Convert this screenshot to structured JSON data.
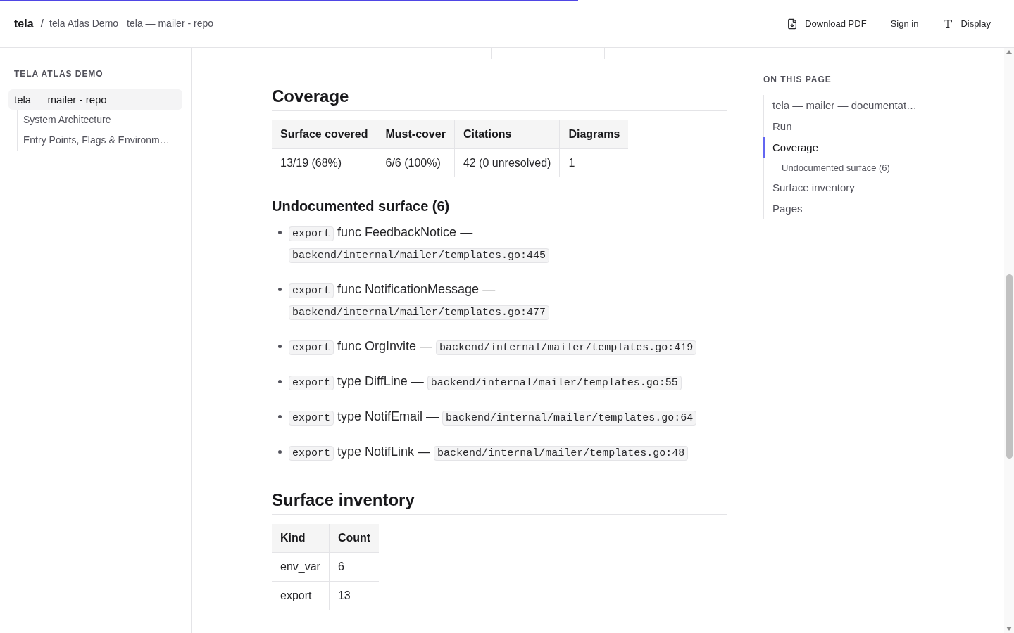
{
  "progress": {
    "level": 0.57
  },
  "header": {
    "brand": "tela",
    "separator": "/",
    "breadcrumbs": [
      "tela Atlas Demo",
      "tela — mailer - repo"
    ],
    "actions": [
      {
        "kind": "download",
        "label": "Download PDF"
      },
      {
        "kind": "link",
        "label": "Sign in"
      },
      {
        "kind": "display",
        "label": "Display"
      }
    ]
  },
  "sidebar": {
    "title": "TELA ATLAS DEMO",
    "items": [
      {
        "label": "tela — mailer - repo",
        "selected": true,
        "children": [
          {
            "label": "System Architecture",
            "selected": false
          },
          {
            "label": "Entry Points, Flags & Environm…",
            "selected": false
          }
        ]
      }
    ]
  },
  "article": {
    "blocks": [
      {
        "kind": "h2",
        "text": "Coverage"
      },
      {
        "kind": "table",
        "columns": [
          "Surface covered",
          "Must-cover",
          "Citations",
          "Diagrams"
        ],
        "rows": [
          [
            "13/19 (68%)",
            "6/6 (100%)",
            "42 (0 unresolved)",
            "1"
          ]
        ]
      },
      {
        "kind": "h3",
        "text": "Undocumented surface (6)"
      },
      {
        "kind": "list",
        "items": [
          {
            "tag": "export",
            "text": "func FeedbackNotice —",
            "path": "backend/internal/mailer/templates.go:445"
          },
          {
            "tag": "export",
            "text": "func NotificationMessage —",
            "path": "backend/internal/mailer/templates.go:477"
          },
          {
            "tag": "export",
            "text": "func OrgInvite —",
            "path": "backend/internal/mailer/templates.go:419"
          },
          {
            "tag": "export",
            "text": "type DiffLine —",
            "path": "backend/internal/mailer/templates.go:55"
          },
          {
            "tag": "export",
            "text": "type NotifEmail —",
            "path": "backend/internal/mailer/templates.go:64"
          },
          {
            "tag": "export",
            "text": "type NotifLink —",
            "path": "backend/internal/mailer/templates.go:48"
          }
        ]
      },
      {
        "kind": "h2",
        "text": "Surface inventory"
      },
      {
        "kind": "table",
        "columns": [
          "Kind",
          "Count"
        ],
        "rows": [
          [
            "env_var",
            "6"
          ],
          [
            "export",
            "13"
          ]
        ]
      }
    ]
  },
  "toc": {
    "title": "ON THIS PAGE",
    "items": [
      {
        "label": "tela — mailer — documentat…",
        "selected": false
      },
      {
        "label": "Run",
        "selected": false
      },
      {
        "label": "Coverage",
        "selected": true,
        "children": [
          {
            "label": "Undocumented surface (6)",
            "selected": false
          }
        ]
      },
      {
        "label": "Surface inventory",
        "selected": false
      },
      {
        "label": "Pages",
        "selected": false
      }
    ]
  }
}
